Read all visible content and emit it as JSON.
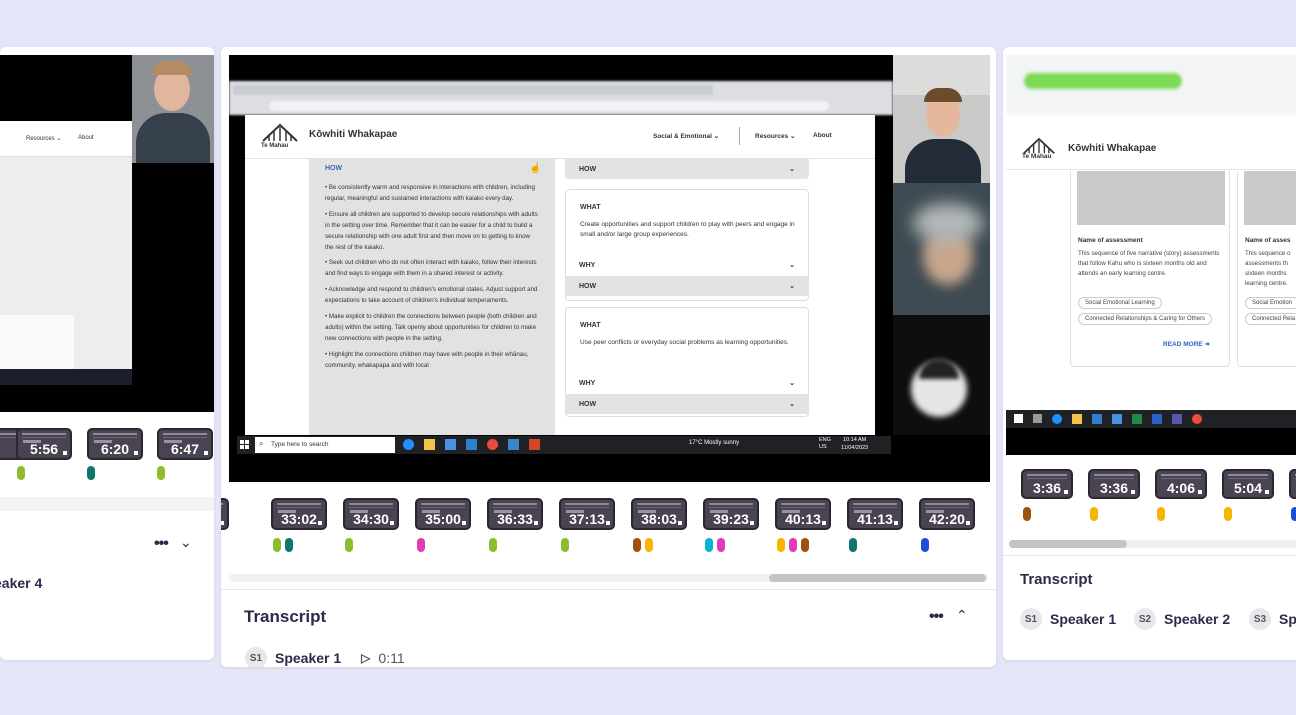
{
  "left": {
    "timestamps": [
      "5:56",
      "6:20",
      "6:47"
    ],
    "speaker_label": "eaker 4",
    "web_nav": [
      "Resources ⌄",
      "About"
    ]
  },
  "center": {
    "site_title": "Kōwhiti Whakapae",
    "logo_text": "Te Mahau",
    "nav": {
      "social": "Social & Emotional ⌄",
      "resources": "Resources ⌄",
      "about": "About"
    },
    "how_label": "HOW",
    "bullets": [
      "Be consistently warm and responsive in interactions with children, including regular, meaningful and sustained interactions with kaiako every day.",
      "Ensure all children are supported to develop secure relationships with adults in the setting over time. Remember that it can be easier for a child to build a secure relationship with one adult first and then move on to getting to know the rest of the kaiako.",
      "Seek out children who do not often interact with kaiako, follow their interests and find ways to engage with them in a shared interest or activity.",
      "Acknowledge and respond to children's emotional states. Adjust support and expectations to take account of children's individual temperaments.",
      "Make explicit to children the connections between people (both children and adults) within the setting. Talk openly about opportunities for children to make new connections with people in the setting.",
      "Highlight the connections children may have with people in their whānau, community, whakapapa and with local"
    ],
    "accordion": {
      "how": "HOW",
      "what": "WHAT",
      "why": "WHY",
      "what1_text": "Create opportunities and support children to play with peers and engage in small and/or large group experiences.",
      "what2_text": "Use peer conflicts or everyday social problems as learning opportunities."
    },
    "taskbar": {
      "search": "Type here to search",
      "weather": "17°C  Mostly sunny",
      "lang": "ENG\nUS",
      "time": "10:14 AM",
      "date": "11/04/2023"
    },
    "timestamps": [
      "2",
      "33:02",
      "34:30",
      "35:00",
      "36:33",
      "37:13",
      "38:03",
      "39:23",
      "40:13",
      "41:13",
      "42:20"
    ],
    "transcript_title": "Transcript",
    "speaker": {
      "badge": "S1",
      "name": "Speaker 1",
      "time": "0:11"
    }
  },
  "right": {
    "site_title": "Kōwhiti Whakapae",
    "logo_text": "Te Mahau",
    "card1": {
      "title": "Name of assessment",
      "text": "This sequence of five narrative (story) assessments that follow Kahu who is sixteen months old and attends an early learning centre.",
      "tags": [
        "Social Emotional Learning",
        "Connected Relationships & Caring for Others"
      ],
      "read_more": "READ MORE"
    },
    "card2": {
      "title": "Name of asses",
      "text": "This sequence o assessments th sixteen months learning centre.",
      "tags": [
        "Social Emotion",
        "Connected Rela"
      ]
    },
    "timestamps": [
      "3:36",
      "3:36",
      "4:06",
      "5:04",
      "5:04"
    ],
    "transcript_title": "Transcript",
    "speakers": [
      {
        "badge": "S1",
        "name": "Speaker 1"
      },
      {
        "badge": "S2",
        "name": "Speaker 2"
      },
      {
        "badge": "S3",
        "name": "Sp"
      }
    ]
  },
  "colors": {
    "background": "#e4e6f7",
    "green": "#8fbc2f",
    "teal": "#0f766e",
    "pink": "#e23bb5",
    "brown": "#a0520d",
    "yellow": "#f7b500",
    "cyan": "#0bb5c9",
    "blue": "#1d4ed8"
  }
}
